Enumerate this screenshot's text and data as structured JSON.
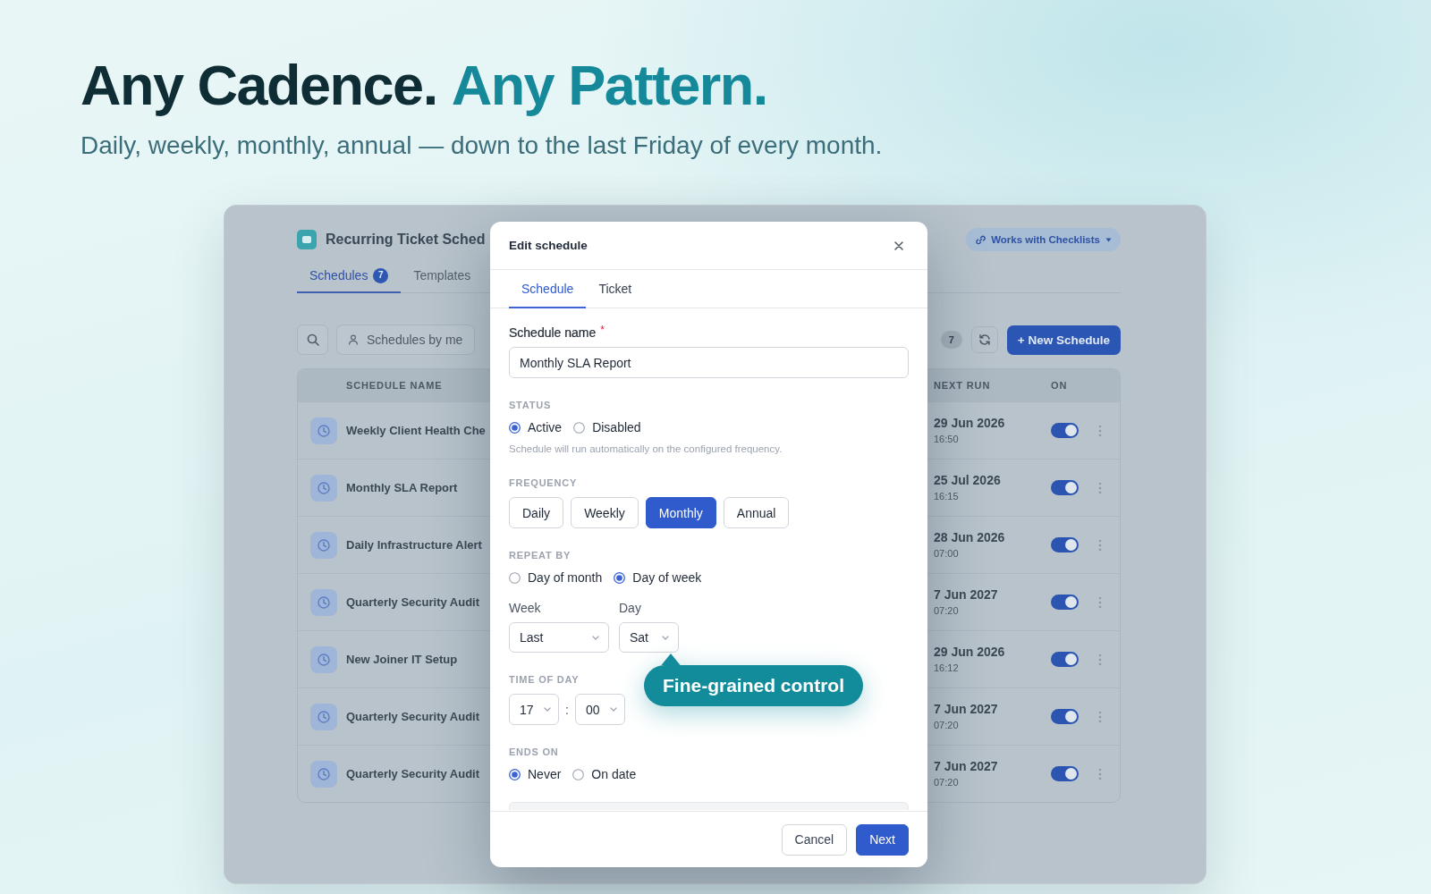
{
  "hero": {
    "title": "Any Cadence.",
    "title_accent": "Any Pattern.",
    "subtitle": "Daily, weekly, monthly, annual — down to the last Friday of every month."
  },
  "app": {
    "title": "Recurring Ticket Sched",
    "feature_pill": "Works with Checklists",
    "tabs": [
      {
        "label": "Schedules",
        "count": "7",
        "selected": true
      },
      {
        "label": "Templates",
        "selected": false
      }
    ],
    "filter": "Schedules by me",
    "schedule_count": "7",
    "new_button": "+ New Schedule",
    "table": {
      "columns": [
        "SCHEDULE NAME",
        "NEXT RUN",
        "ON"
      ],
      "rows": [
        {
          "name": "Weekly Client Health Che",
          "next_run": "29 Jun 2026",
          "time": "16:50",
          "on": true
        },
        {
          "name": "Monthly SLA Report",
          "next_run": "25 Jul 2026",
          "time": "16:15",
          "on": true
        },
        {
          "name": "Daily Infrastructure Alert",
          "next_run": "28 Jun 2026",
          "time": "07:00",
          "on": true
        },
        {
          "name": "Quarterly Security Audit",
          "next_run": "7 Jun 2027",
          "time": "07:20",
          "on": true
        },
        {
          "name": "New Joiner IT Setup",
          "next_run": "29 Jun 2026",
          "time": "16:12",
          "on": true
        },
        {
          "name": "Quarterly Security Audit",
          "next_run": "7 Jun 2027",
          "time": "07:20",
          "on": true
        },
        {
          "name": "Quarterly Security Audit",
          "next_run": "7 Jun 2027",
          "time": "07:20",
          "on": true
        }
      ]
    }
  },
  "dialog": {
    "title": "Edit schedule",
    "tabs": [
      {
        "label": "Schedule",
        "selected": true
      },
      {
        "label": "Ticket",
        "selected": false
      }
    ],
    "name_field": {
      "label": "Schedule name",
      "required_mark": "*",
      "value": "Monthly SLA Report"
    },
    "status": {
      "heading": "STATUS",
      "options": [
        {
          "label": "Active",
          "selected": true
        },
        {
          "label": "Disabled",
          "selected": false
        }
      ],
      "hint": "Schedule will run automatically on the configured frequency."
    },
    "frequency": {
      "heading": "FREQUENCY",
      "options": [
        {
          "label": "Daily",
          "selected": false
        },
        {
          "label": "Weekly",
          "selected": false
        },
        {
          "label": "Monthly",
          "selected": true
        },
        {
          "label": "Annual",
          "selected": false
        }
      ]
    },
    "repeat_by": {
      "heading": "REPEAT BY",
      "options": [
        {
          "label": "Day of month",
          "selected": false
        },
        {
          "label": "Day of week",
          "selected": true
        }
      ],
      "week": {
        "label": "Week",
        "value": "Last"
      },
      "day": {
        "label": "Day",
        "value": "Sat"
      }
    },
    "time_of_day": {
      "heading": "TIME OF DAY",
      "hour": "17",
      "separator": ":",
      "minute": "00"
    },
    "ends_on": {
      "heading": "ENDS ON",
      "options": [
        {
          "label": "Never",
          "selected": true
        },
        {
          "label": "On date",
          "selected": false
        }
      ]
    },
    "body_continues": true,
    "buttons": [
      {
        "label": "Cancel",
        "kind": "secondary"
      },
      {
        "label": "Next",
        "kind": "primary"
      }
    ]
  },
  "callout": {
    "text": "Fine-grained control"
  }
}
